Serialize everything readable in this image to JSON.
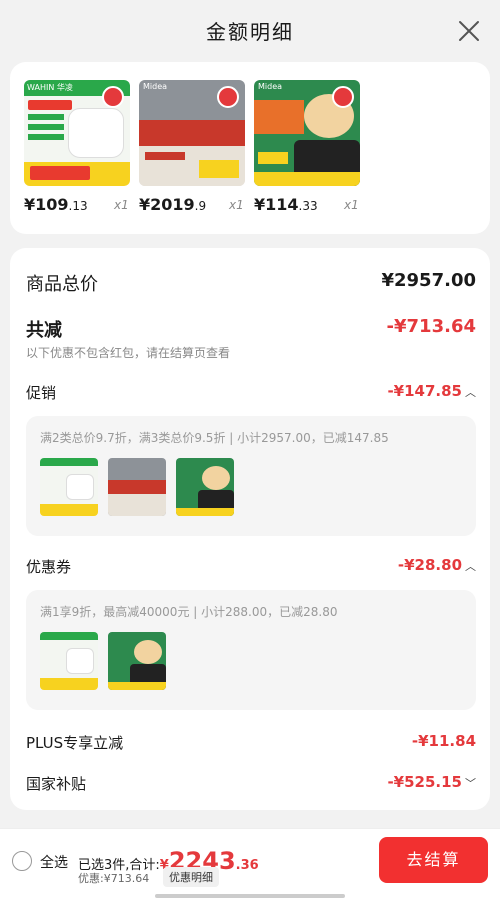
{
  "header": {
    "title": "金额明细",
    "close_icon": "close-icon"
  },
  "products": [
    {
      "int": "¥109",
      "dec": ".13",
      "qty": "x1",
      "brand": "WAHIN 华凌",
      "colors": [
        "#2aa84a",
        "#f5f5f5",
        "#e83a2f"
      ]
    },
    {
      "int": "¥2019",
      "dec": ".9",
      "qty": "x1",
      "brand": "Midea",
      "colors": [
        "#c8382b",
        "#8a8f96",
        "#e8e2d8"
      ]
    },
    {
      "int": "¥114",
      "dec": ".33",
      "qty": "x1",
      "brand": "Midea",
      "colors": [
        "#2d8a4e",
        "#e8702a",
        "#f2d3a0"
      ]
    }
  ],
  "detail": {
    "total_label": "商品总价",
    "total_value": "¥2957.00",
    "reduce_label": "共减",
    "reduce_value": "-¥713.64",
    "reduce_note": "以下优惠不包含红包，请在结算页查看",
    "promo_label": "促销",
    "promo_value": "-¥147.85",
    "promo_desc": "满2类总价9.7折，满3类总价9.5折 | 小计2957.00，已减147.85",
    "coupon_label": "优惠券",
    "coupon_value": "-¥28.80",
    "coupon_desc": "满1享9折，最高减40000元 | 小计288.00，已减28.80",
    "plus_label": "PLUS专享立减",
    "plus_value": "-¥11.84",
    "subsidy_label": "国家补贴",
    "subsidy_value": "-¥525.15"
  },
  "bottom": {
    "select_all": "全选",
    "selected_text": "已选3件,合计:",
    "total_yen": "¥",
    "total_int": "2243",
    "total_dec": ".36",
    "discount_text": "优惠:¥713.64",
    "detail_tag": "优惠明细",
    "pay_button": "去结算"
  }
}
